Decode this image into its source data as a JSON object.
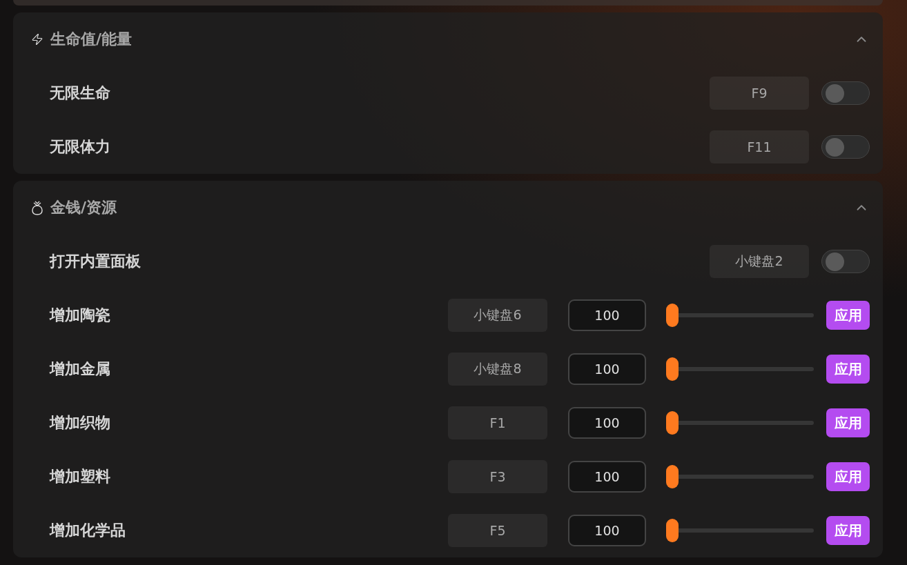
{
  "sections": [
    {
      "title": "生命值/能量",
      "expanded": true,
      "rows": [
        {
          "kind": "toggle",
          "label": "无限生命",
          "hotkey": "F9",
          "on": false
        },
        {
          "kind": "toggle",
          "label": "无限体力",
          "hotkey": "F11",
          "on": false
        }
      ]
    },
    {
      "title": "金钱/资源",
      "expanded": true,
      "rows": [
        {
          "kind": "toggle",
          "label": "打开内置面板",
          "hotkey": "小键盘2",
          "on": false
        },
        {
          "kind": "amount",
          "label": "增加陶瓷",
          "hotkey": "小键盘6",
          "value": "100",
          "level": 0,
          "button": "应用"
        },
        {
          "kind": "amount",
          "label": "增加金属",
          "hotkey": "小键盘8",
          "value": "100",
          "level": 0,
          "button": "应用"
        },
        {
          "kind": "amount",
          "label": "增加织物",
          "hotkey": "F1",
          "value": "100",
          "level": 0,
          "button": "应用"
        },
        {
          "kind": "amount",
          "label": "增加塑料",
          "hotkey": "F3",
          "value": "100",
          "level": 0,
          "button": "应用"
        },
        {
          "kind": "amount",
          "label": "增加化学品",
          "hotkey": "F5",
          "value": "100",
          "level": 0,
          "button": "应用"
        }
      ]
    }
  ]
}
